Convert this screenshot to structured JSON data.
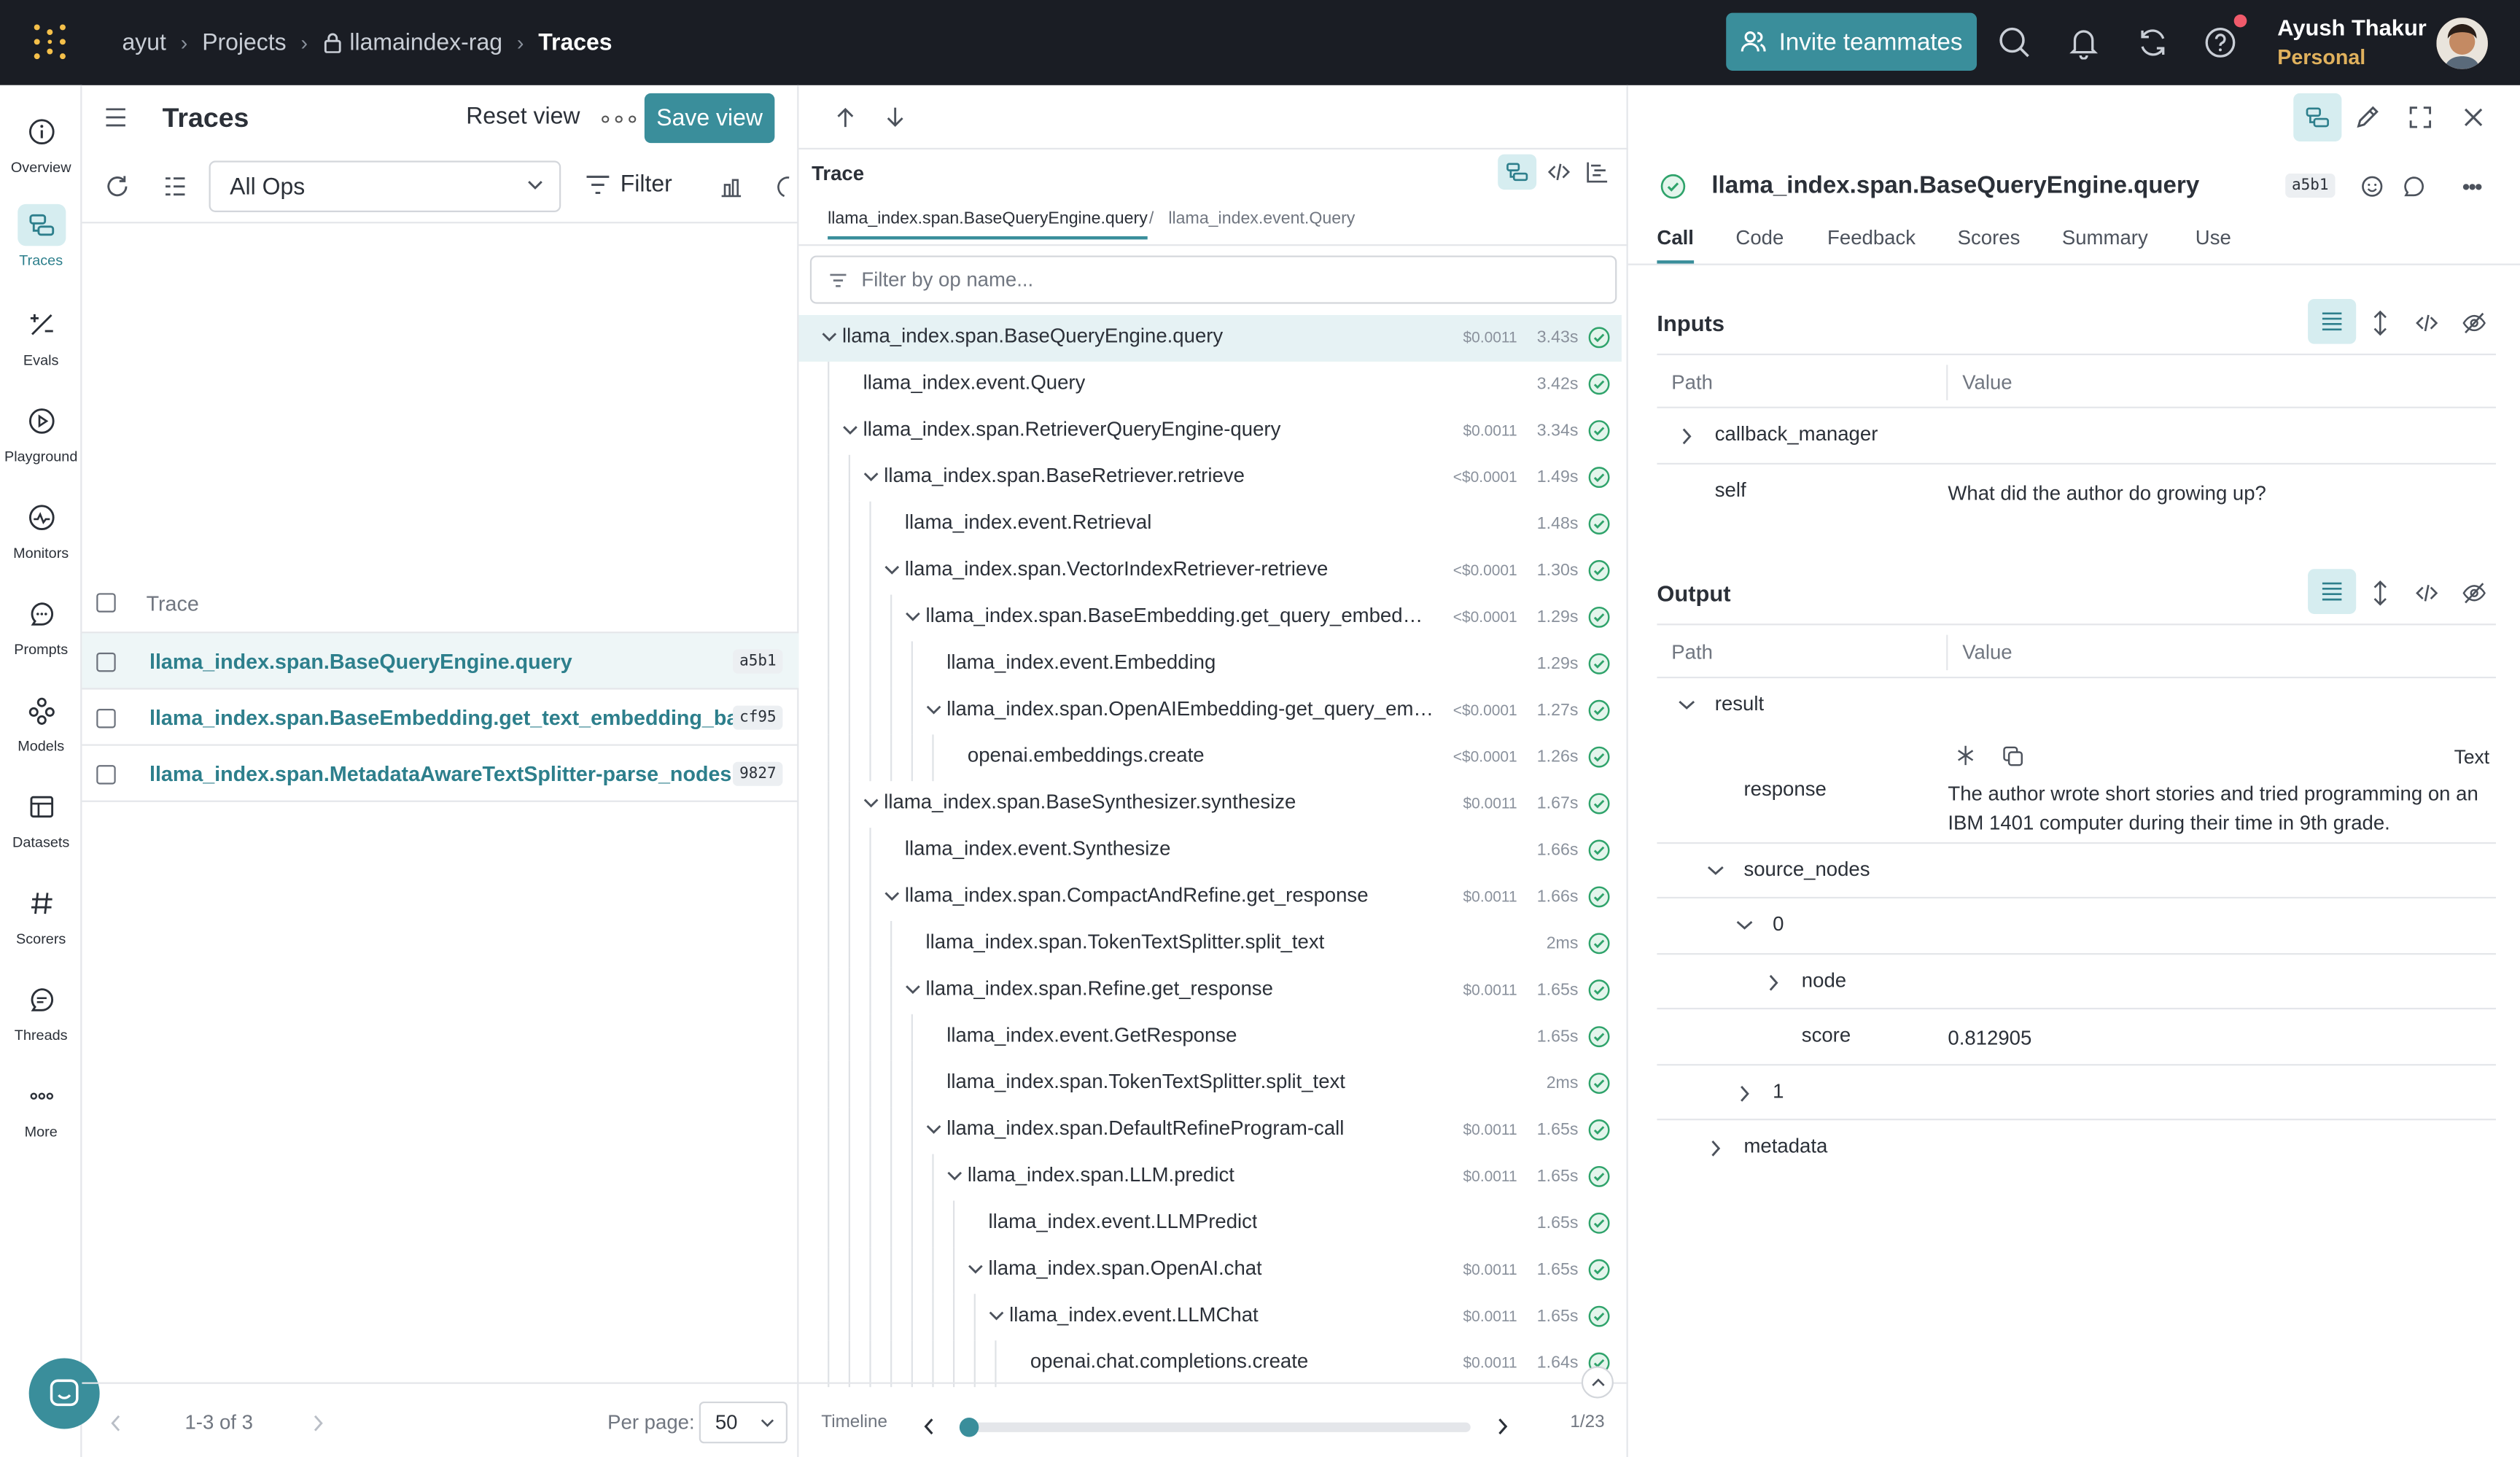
{
  "topbar": {
    "breadcrumbs": [
      "ayut",
      "Projects",
      "llamaindex-rag",
      "Traces"
    ],
    "invite_label": "Invite teammates",
    "user_name": "Ayush Thakur",
    "user_plan": "Personal"
  },
  "nav": [
    {
      "label": "Overview",
      "icon": "info-icon"
    },
    {
      "label": "Traces",
      "icon": "traces-icon",
      "active": true
    },
    {
      "label": "Evals",
      "icon": "evals-icon"
    },
    {
      "label": "Playground",
      "icon": "play-icon"
    },
    {
      "label": "Monitors",
      "icon": "monitor-icon"
    },
    {
      "label": "Prompts",
      "icon": "chat-icon"
    },
    {
      "label": "Models",
      "icon": "models-icon"
    },
    {
      "label": "Datasets",
      "icon": "table-icon"
    },
    {
      "label": "Scorers",
      "icon": "hash-icon"
    },
    {
      "label": "Threads",
      "icon": "thread-icon"
    },
    {
      "label": "More",
      "icon": "more-icon"
    }
  ],
  "traces_panel": {
    "title": "Traces",
    "reset_label": "Reset view",
    "save_label": "Save view",
    "ops_select": "All Ops",
    "filter_label": "Filter",
    "column_header": "Trace",
    "rows": [
      {
        "name": "llama_index.span.BaseQueryEngine.query",
        "id": "a5b1"
      },
      {
        "name": "llama_index.span.BaseEmbedding.get_text_embedding_batch",
        "id": "cf95"
      },
      {
        "name": "llama_index.span.MetadataAwareTextSplitter-parse_nodes",
        "id": "9827"
      }
    ],
    "pager_range": "1-3 of 3",
    "per_page_label": "Per page:",
    "per_page_value": "50"
  },
  "trace_tree": {
    "label": "Trace",
    "tab_active": "llama_index.span.BaseQueryEngine.query",
    "tab_other": "llama_index.event.Query",
    "filter_placeholder": "Filter by op name...",
    "nodes": [
      {
        "name": "llama_index.span.BaseQueryEngine.query",
        "cost": "$0.0011",
        "dur": "3.43s",
        "depth": 0,
        "caret": true
      },
      {
        "name": "llama_index.event.Query",
        "cost": "",
        "dur": "3.42s",
        "depth": 1,
        "caret": false
      },
      {
        "name": "llama_index.span.RetrieverQueryEngine-query",
        "cost": "$0.0011",
        "dur": "3.34s",
        "depth": 1,
        "caret": true
      },
      {
        "name": "llama_index.span.BaseRetriever.retrieve",
        "cost": "<$0.0001",
        "dur": "1.49s",
        "depth": 2,
        "caret": true
      },
      {
        "name": "llama_index.event.Retrieval",
        "cost": "",
        "dur": "1.48s",
        "depth": 3,
        "caret": false
      },
      {
        "name": "llama_index.span.VectorIndexRetriever-retrieve",
        "cost": "<$0.0001",
        "dur": "1.30s",
        "depth": 3,
        "caret": true
      },
      {
        "name": "llama_index.span.BaseEmbedding.get_query_embedd…",
        "cost": "<$0.0001",
        "dur": "1.29s",
        "depth": 4,
        "caret": true
      },
      {
        "name": "llama_index.event.Embedding",
        "cost": "",
        "dur": "1.29s",
        "depth": 5,
        "caret": false
      },
      {
        "name": "llama_index.span.OpenAIEmbedding-get_query_em…",
        "cost": "<$0.0001",
        "dur": "1.27s",
        "depth": 5,
        "caret": true
      },
      {
        "name": "openai.embeddings.create",
        "cost": "<$0.0001",
        "dur": "1.26s",
        "depth": 6,
        "caret": false
      },
      {
        "name": "llama_index.span.BaseSynthesizer.synthesize",
        "cost": "$0.0011",
        "dur": "1.67s",
        "depth": 2,
        "caret": true
      },
      {
        "name": "llama_index.event.Synthesize",
        "cost": "",
        "dur": "1.66s",
        "depth": 3,
        "caret": false
      },
      {
        "name": "llama_index.span.CompactAndRefine.get_response",
        "cost": "$0.0011",
        "dur": "1.66s",
        "depth": 3,
        "caret": true
      },
      {
        "name": "llama_index.span.TokenTextSplitter.split_text",
        "cost": "",
        "dur": "2ms",
        "depth": 4,
        "caret": false
      },
      {
        "name": "llama_index.span.Refine.get_response",
        "cost": "$0.0011",
        "dur": "1.65s",
        "depth": 4,
        "caret": true
      },
      {
        "name": "llama_index.event.GetResponse",
        "cost": "",
        "dur": "1.65s",
        "depth": 5,
        "caret": false
      },
      {
        "name": "llama_index.span.TokenTextSplitter.split_text",
        "cost": "",
        "dur": "2ms",
        "depth": 5,
        "caret": false
      },
      {
        "name": "llama_index.span.DefaultRefineProgram-call",
        "cost": "$0.0011",
        "dur": "1.65s",
        "depth": 5,
        "caret": true
      },
      {
        "name": "llama_index.span.LLM.predict",
        "cost": "$0.0011",
        "dur": "1.65s",
        "depth": 6,
        "caret": true
      },
      {
        "name": "llama_index.event.LLMPredict",
        "cost": "",
        "dur": "1.65s",
        "depth": 7,
        "caret": false
      },
      {
        "name": "llama_index.span.OpenAI.chat",
        "cost": "$0.0011",
        "dur": "1.65s",
        "depth": 7,
        "caret": true
      },
      {
        "name": "llama_index.event.LLMChat",
        "cost": "$0.0011",
        "dur": "1.65s",
        "depth": 8,
        "caret": true
      },
      {
        "name": "openai.chat.completions.create",
        "cost": "$0.0011",
        "dur": "1.64s",
        "depth": 9,
        "caret": false
      }
    ],
    "timeline_label": "Timeline",
    "timeline_count": "1/23"
  },
  "detail": {
    "title": "llama_index.span.BaseQueryEngine.query",
    "id": "a5b1",
    "tabs": [
      "Call",
      "Code",
      "Feedback",
      "Scores",
      "Summary",
      "Use"
    ],
    "inputs_title": "Inputs",
    "outputs_title": "Output",
    "path_header": "Path",
    "value_header": "Value",
    "inputs": {
      "callback_manager": "callback_manager",
      "self_key": "self",
      "self_value": "What did the author do growing up?"
    },
    "output": {
      "result": "result",
      "text_toggle": "Text",
      "response_key": "response",
      "response_value": "The author wrote short stories and tried programming on an IBM 1401 computer during their time in 9th grade.",
      "source_nodes": "source_nodes",
      "idx0": "0",
      "node": "node",
      "score_key": "score",
      "score_value": "0.812905",
      "idx1": "1",
      "metadata": "metadata"
    }
  },
  "colors": {
    "accent": "#3a8e9b",
    "topbar": "#1a1d24",
    "ok": "#2fa36b"
  }
}
